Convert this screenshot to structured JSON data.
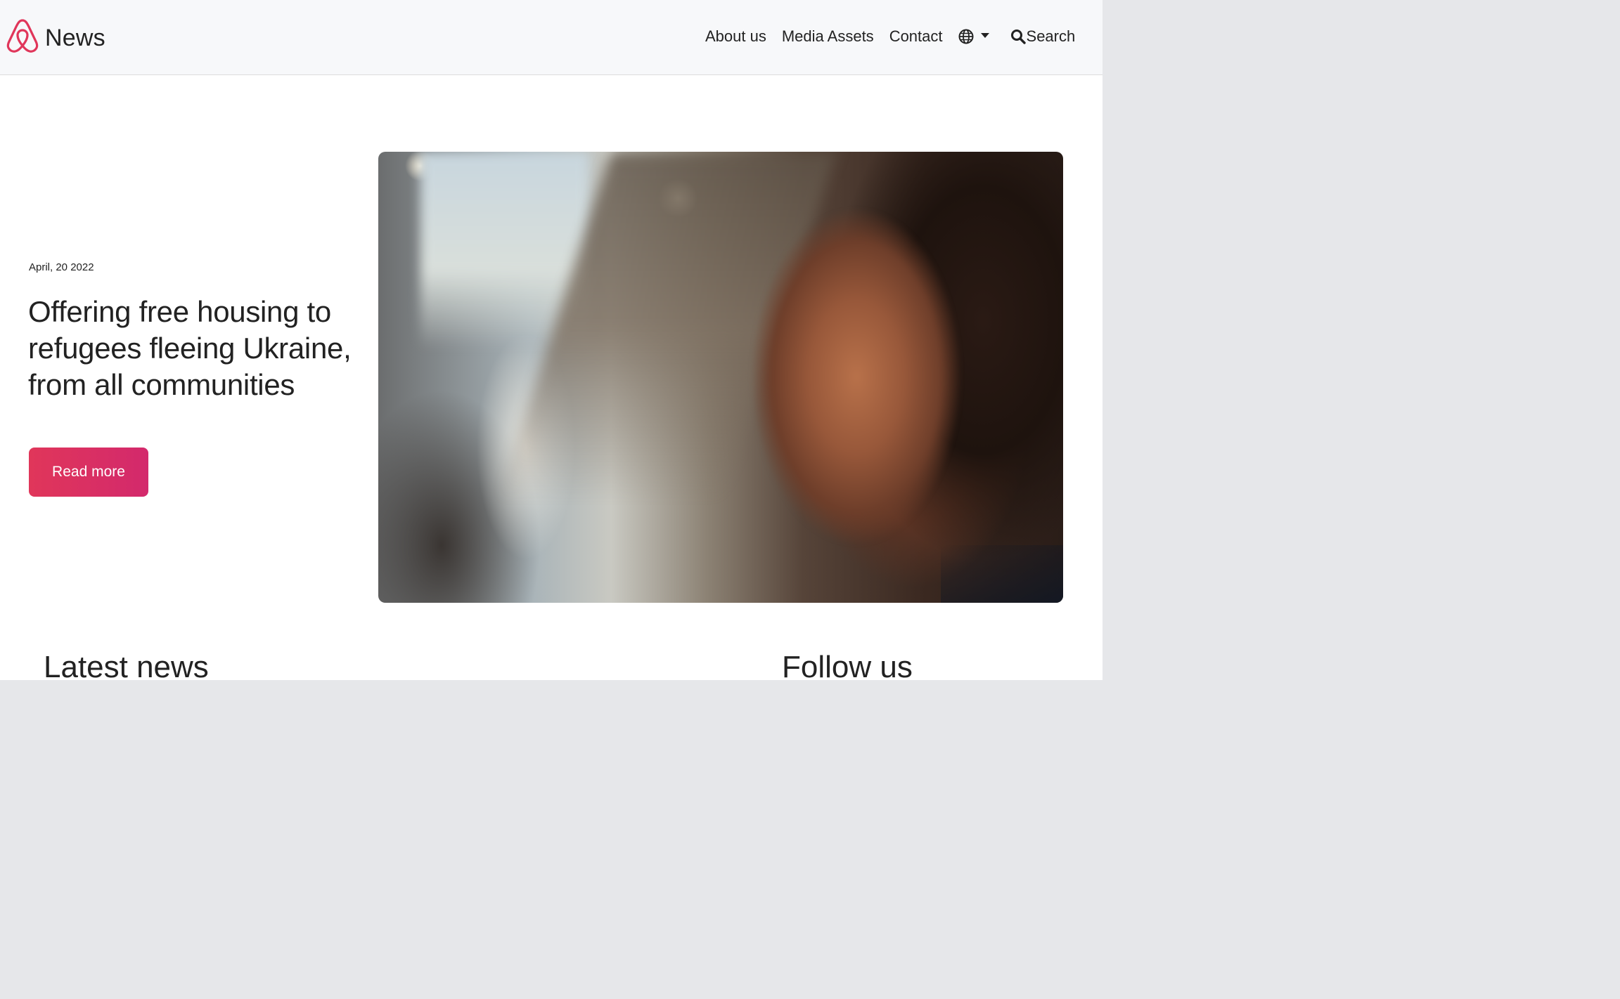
{
  "header": {
    "brand_text": "News",
    "nav": {
      "about": "About us",
      "media": "Media Assets",
      "contact": "Contact",
      "language_icon": "globe-icon",
      "search_label": "Search"
    }
  },
  "hero": {
    "date": "April, 20 2022",
    "title": "Offering free housing to refugees fleeing Ukraine, from all communities",
    "button_label": "Read more",
    "image_alt": "Woman looking into the distance"
  },
  "sections": {
    "latest_news": "Latest news",
    "follow_us": "Follow us"
  },
  "colors": {
    "brand": "#e0365a",
    "button_gradient_end": "#d3296c",
    "text": "#222222",
    "header_bg": "#f7f8fa"
  }
}
